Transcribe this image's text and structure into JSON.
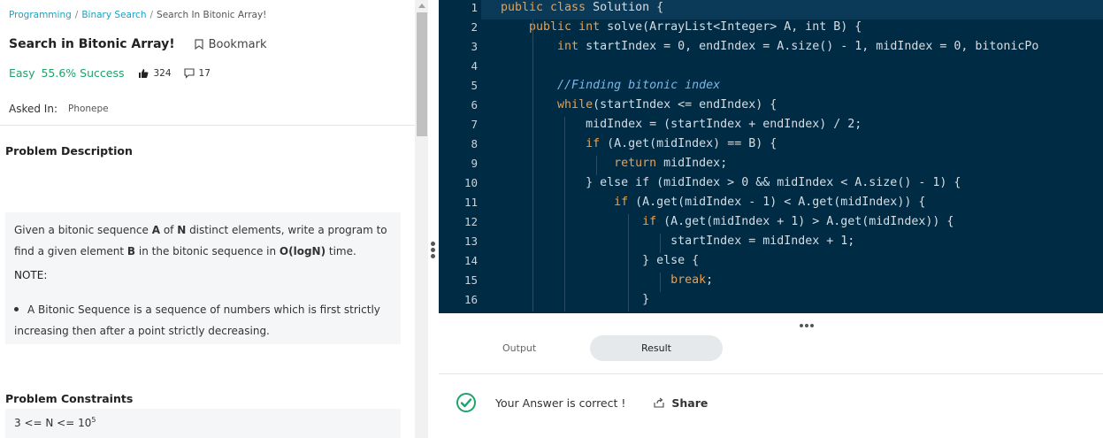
{
  "breadcrumb": {
    "items": [
      "Programming",
      "Binary Search",
      "Search In Bitonic Array!"
    ],
    "separator": "/"
  },
  "problem": {
    "title": "Search in Bitonic Array!",
    "bookmark_label": "Bookmark",
    "difficulty": "Easy",
    "success_rate": "55.6% Success",
    "likes": "324",
    "dislikes": "17",
    "asked_in_label": "Asked In:",
    "company": "Phonepe"
  },
  "description": {
    "section_title": "Problem Description",
    "text_1a": "Given a bitonic sequence ",
    "var_A": "A",
    "text_1b": " of ",
    "var_N": "N",
    "text_1c": " distinct elements, write a program to find a given element ",
    "var_B": "B",
    "text_1d": " in the bitonic sequence in ",
    "complexity": "O(logN)",
    "text_1e": " time.",
    "note_label": "NOTE:",
    "bullet": "A Bitonic Sequence is a sequence of numbers which is first strictly increasing then after a point strictly decreasing."
  },
  "constraints": {
    "section_title": "Problem Constraints",
    "line_prefix": "3 <= N <= 10",
    "line_exponent": "5"
  },
  "editor": {
    "line_numbers": [
      "1",
      "2",
      "3",
      "4",
      "5",
      "6",
      "7",
      "8",
      "9",
      "10",
      "11",
      "12",
      "13",
      "14",
      "15",
      "16"
    ],
    "lines": [
      {
        "kw": "public class",
        "rest": " Solution {"
      },
      {
        "indent": "    ",
        "kw": "public int",
        "rest": " solve(ArrayList<Integer> A, int B) {"
      },
      {
        "indent": "        ",
        "kw": "int",
        "rest": " startIndex = 0, endIndex = A.size() - 1, midIndex = 0, bitonicPo"
      },
      {
        "rest": ""
      },
      {
        "indent": "        ",
        "comment": "//Finding bitonic index"
      },
      {
        "indent": "        ",
        "kw": "while",
        "rest": "(startIndex <= endIndex) {"
      },
      {
        "indent": "            ",
        "rest": "midIndex = (startIndex + endIndex) / 2;"
      },
      {
        "indent": "            ",
        "kw": "if",
        "rest": " (A.get(midIndex) == B) {"
      },
      {
        "indent": "                ",
        "kw": "return",
        "rest": " midIndex;"
      },
      {
        "indent": "            ",
        "rest": "} else if (midIndex > 0 && midIndex < A.size() - 1) {"
      },
      {
        "indent": "                ",
        "kw": "if",
        "rest": " (A.get(midIndex - 1) < A.get(midIndex)) {"
      },
      {
        "indent": "                    ",
        "kw": "if",
        "rest": " (A.get(midIndex + 1) > A.get(midIndex)) {"
      },
      {
        "indent": "                        ",
        "rest": "startIndex = midIndex + 1;"
      },
      {
        "indent": "                    ",
        "rest": "} else {"
      },
      {
        "indent": "                        ",
        "kw": "break",
        "rest": ";"
      },
      {
        "indent": "                    ",
        "rest": "}"
      }
    ]
  },
  "output": {
    "tab_output": "Output",
    "tab_result": "Result",
    "result_message": "Your Answer is correct !",
    "share_label": "Share"
  },
  "colors": {
    "accent": "#1fa36b",
    "link": "#1aa3c2",
    "editor_bg": "#002b45",
    "keyword": "#e8a04f"
  }
}
